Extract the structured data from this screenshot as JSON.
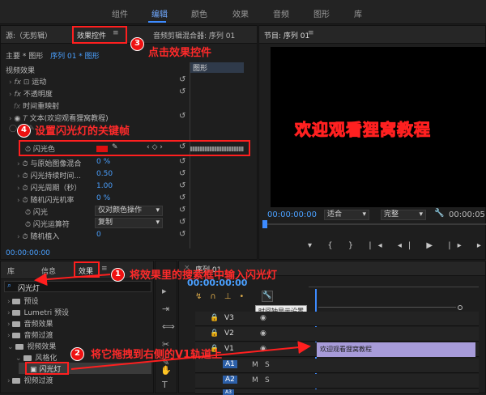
{
  "workspace_tabs": [
    "组件",
    "编辑",
    "颜色",
    "效果",
    "音频",
    "图形",
    "库"
  ],
  "source_panel": {
    "source_tab": "源:（无剪辑）",
    "effect_controls_tab": "效果控件",
    "audio_mixer_tab": "音频剪辑混合器: 序列 01"
  },
  "effect_controls": {
    "breadcrumb_master": "主要 * 图形",
    "breadcrumb_seq": "序列 01 * 图形",
    "clip_label": "图形",
    "section_video": "视频效果",
    "rows": {
      "motion": "运动",
      "opacity": "不透明度",
      "time_remap": "时间重映射",
      "text": "文本(欢迎观看狸窝教程)",
      "flash_color": "闪光色",
      "blend": "与原始图像混合",
      "blend_val": "0 %",
      "duration": "闪光持续时间...",
      "duration_val": "0.50",
      "period": "闪光周期（秒）",
      "period_val": "1.00",
      "probability": "随机闪光机率",
      "probability_val": "0 %",
      "flash": "闪光",
      "flash_val": "仅对颜色操作",
      "operator": "闪光运算符",
      "operator_val": "复制",
      "seed": "随机植入",
      "seed_val": "0"
    },
    "timecode": "00:00:00:00"
  },
  "program_panel": {
    "title": "节目: 序列 01",
    "preview_text": "欢迎观看狸窝教程",
    "timecode": "00:00:00:00",
    "fit": "适合",
    "quality": "完整",
    "end_timecode": "00:00:05:0"
  },
  "effects_panel": {
    "tabs": {
      "library": "库",
      "info": "信息",
      "effects": "效果"
    },
    "search_value": "闪光灯",
    "tree": [
      "预设",
      "Lumetri 预设",
      "音频效果",
      "音频过渡",
      "视频效果",
      "风格化",
      "闪光灯",
      "视频过渡"
    ]
  },
  "timeline": {
    "seq_tab": "序列 01",
    "timecode": "00:00:00:00",
    "tooltip": "时间轴显示设置",
    "clip_label": "欢迎观看狸窝教程",
    "tracks": [
      "V3",
      "V2",
      "V1",
      "A1",
      "A2",
      "A3"
    ]
  },
  "annotations": {
    "a1": "将效果里的搜索框中输入闪光灯",
    "a2": "将它拖拽到右侧的V1轨道上",
    "a3": "点击效果控件",
    "a4": "设置闪光灯的关键帧",
    "n1": "1",
    "n2": "2",
    "n3": "3",
    "n4": "4"
  },
  "colors": {
    "accent": "#3d8bff",
    "annotation_red": "#ff2222",
    "clip_purple": "#a79bd9"
  }
}
